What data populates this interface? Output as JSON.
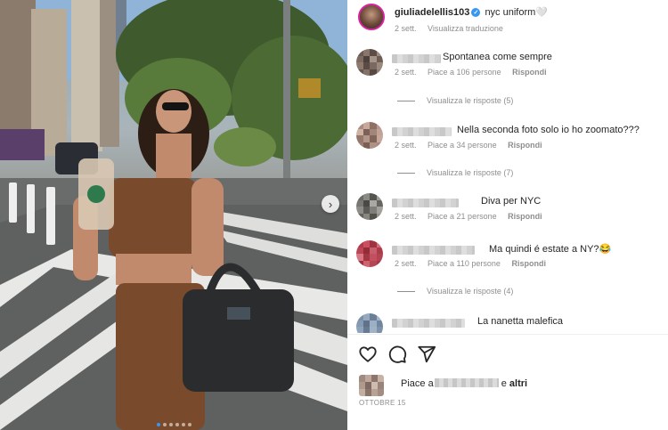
{
  "post": {
    "username": "giuliadelellis103",
    "caption": "nyc uniform🤍",
    "time": "2 sett.",
    "translate_label": "Visualizza traduzione",
    "carousel": {
      "slide_count": 6,
      "active_index": 0,
      "next_icon": "chevron-right-icon"
    }
  },
  "comments": [
    {
      "text": "Spontanea come sempre",
      "time": "2 sett.",
      "likes": "Piace a 106 persone",
      "reply": "Rispondi",
      "replies": "Visualizza le risposte (5)"
    },
    {
      "text": "Nella seconda foto solo io ho zoomato???",
      "time": "2 sett.",
      "likes": "Piace a 34 persone",
      "reply": "Rispondi",
      "replies": "Visualizza le risposte (7)"
    },
    {
      "text": "Diva per NYC",
      "time": "2 sett.",
      "likes": "Piace a 21 persone",
      "reply": "Rispondi",
      "replies": ""
    },
    {
      "text": "Ma quindi é estate a NY?😂",
      "time": "2 sett.",
      "likes": "Piace a 110 persone",
      "reply": "Rispondi",
      "replies": "Visualizza le risposte (4)"
    },
    {
      "text": "La nanetta malefica"
    }
  ],
  "actions": {
    "like_icon": "heart-icon",
    "comment_icon": "comment-icon",
    "share_icon": "share-icon"
  },
  "likes_summary": {
    "prefix": "Piace a",
    "connector": "e",
    "others": "altri"
  },
  "date": "OTTOBRE 15",
  "colors": {
    "accent": "#3897f0",
    "muted": "#8e8e8e",
    "text": "#262626"
  }
}
